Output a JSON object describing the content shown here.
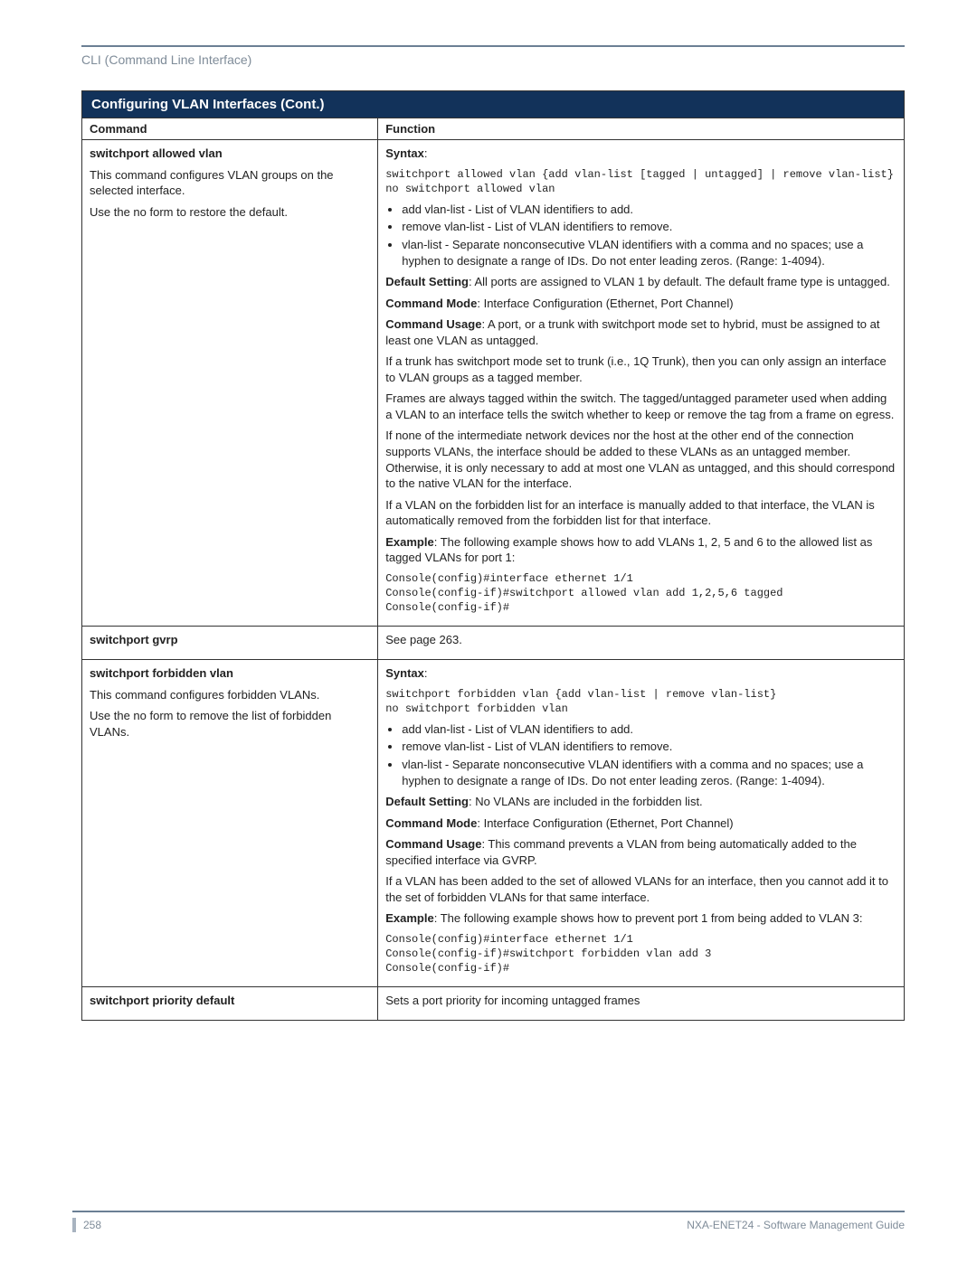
{
  "header": {
    "section": "CLI (Command Line Interface)"
  },
  "table": {
    "title": "Configuring VLAN Interfaces (Cont.)",
    "columns": {
      "command": "Command",
      "function": "Function"
    },
    "rows": [
      {
        "command_name": "switchport allowed vlan",
        "command_desc1": "This command configures VLAN groups on the selected interface.",
        "command_desc2": "Use the no form to restore the default.",
        "syntax_label": "Syntax",
        "syntax_code": "switchport allowed vlan {add vlan-list [tagged | untagged] | remove vlan-list}\nno switchport allowed vlan",
        "bullets": [
          "add vlan-list - List of VLAN identifiers to add.",
          "remove vlan-list - List of VLAN identifiers to remove.",
          "vlan-list - Separate nonconsecutive VLAN identifiers with a comma and no spaces; use a hyphen to designate a range of IDs. Do not enter leading zeros. (Range: 1-4094)."
        ],
        "default_label": "Default Setting",
        "default_text": ": All ports are assigned to VLAN 1 by default. The default frame type is untagged.",
        "mode_label": "Command Mode",
        "mode_text": ": Interface Configuration (Ethernet, Port Channel)",
        "usage_label": "Command Usage",
        "usage_text": ": A port, or a trunk with switchport mode set to hybrid, must be assigned to at least one VLAN as untagged.",
        "para1": "If a trunk has switchport mode set to trunk (i.e., 1Q Trunk), then you can only assign an interface to VLAN groups as a tagged member.",
        "para2": "Frames are always tagged within the switch. The tagged/untagged parameter used when adding a VLAN to an interface tells the switch whether to keep or remove the tag from a frame on egress.",
        "para3": "If none of the intermediate network devices nor the host at the other end of the connection supports VLANs, the interface should be added to these VLANs as an untagged member. Otherwise, it is only necessary to add at most one VLAN as untagged, and this should correspond to the native VLAN for the interface.",
        "para4": "If a VLAN on the forbidden list for an interface is manually added to that interface, the VLAN is automatically removed from the forbidden list for that interface.",
        "example_label": "Example",
        "example_text": ": The following example shows how to add VLANs 1, 2, 5 and 6 to the allowed list as tagged VLANs for port 1:",
        "example_code": "Console(config)#interface ethernet 1/1\nConsole(config-if)#switchport allowed vlan add 1,2,5,6 tagged\nConsole(config-if)#"
      },
      {
        "command_name": "switchport gvrp",
        "function_text": "See page 263."
      },
      {
        "command_name": "switchport forbidden vlan",
        "command_desc1": "This command configures forbidden VLANs.",
        "command_desc2": "Use the no form to remove the list of forbidden VLANs.",
        "syntax_label": "Syntax",
        "syntax_code": "switchport forbidden vlan {add vlan-list | remove vlan-list}\nno switchport forbidden vlan",
        "bullets": [
          "add vlan-list - List of VLAN identifiers to add.",
          "remove vlan-list - List of VLAN identifiers to remove.",
          "vlan-list - Separate nonconsecutive VLAN identifiers with a comma and no spaces; use a hyphen to designate a range of IDs. Do not enter leading zeros. (Range: 1-4094)."
        ],
        "default_label": "Default Setting",
        "default_text": ": No VLANs are included in the forbidden list.",
        "mode_label": "Command Mode",
        "mode_text": ": Interface Configuration (Ethernet, Port Channel)",
        "usage_label": "Command Usage",
        "usage_text": ": This command prevents a VLAN from being automatically added to the specified interface via GVRP.",
        "para1": "If a VLAN has been added to the set of allowed VLANs for an interface, then you cannot add it to the set of forbidden VLANs for that same interface.",
        "example_label": "Example",
        "example_text": ": The following example shows how to prevent port 1 from being added to VLAN 3:",
        "example_code": "Console(config)#interface ethernet 1/1\nConsole(config-if)#switchport forbidden vlan add 3\nConsole(config-if)#"
      },
      {
        "command_name": "switchport priority default",
        "function_text": "Sets a port priority for incoming untagged frames"
      }
    ]
  },
  "footer": {
    "page_number": "258",
    "doc_title": "NXA-ENET24 - Software Management Guide"
  }
}
